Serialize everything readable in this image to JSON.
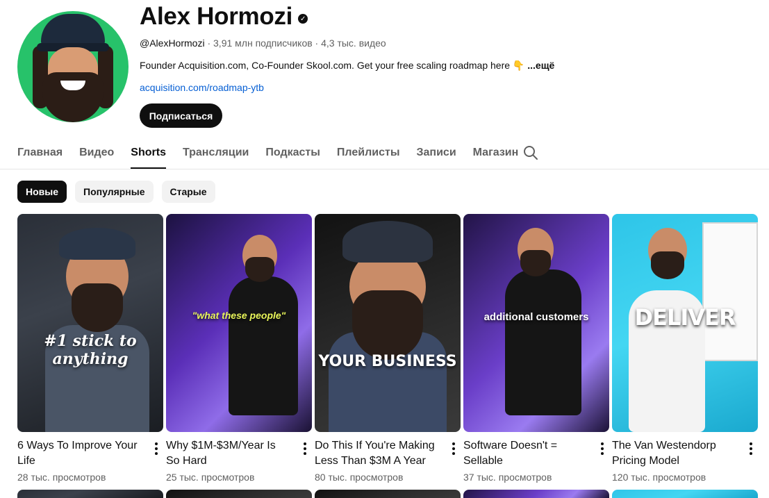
{
  "channel": {
    "name": "Alex Hormozi",
    "handle": "@AlexHormozi",
    "meta_rest": " · 3,91 млн подписчиков · 4,3 тыс. видео",
    "description": "Founder Acquisition.com, Co-Founder Skool.com. Get your free scaling roadmap here 👇 ",
    "more_label": "...ещё",
    "link": "acquisition.com/roadmap-ytb",
    "subscribe_label": "Подписаться",
    "verified_icon": "✓"
  },
  "tabs": [
    {
      "label": "Главная",
      "active": false
    },
    {
      "label": "Видео",
      "active": false
    },
    {
      "label": "Shorts",
      "active": true
    },
    {
      "label": "Трансляции",
      "active": false
    },
    {
      "label": "Подкасты",
      "active": false
    },
    {
      "label": "Плейлисты",
      "active": false
    },
    {
      "label": "Записи",
      "active": false
    },
    {
      "label": "Магазин",
      "active": false
    }
  ],
  "chips": [
    {
      "label": "Новые",
      "selected": true
    },
    {
      "label": "Популярные",
      "selected": false
    },
    {
      "label": "Старые",
      "selected": false
    }
  ],
  "shorts": [
    {
      "title": "6 Ways To Improve Your Life",
      "views": "28 тыс. просмотров",
      "caption": "#1 stick to anything"
    },
    {
      "title": "Why $1M-$3M/Year Is So Hard",
      "views": "25 тыс. просмотров",
      "caption": "\"what these people\""
    },
    {
      "title": "Do This If You're Making Less Than $3M A Year",
      "views": "80 тыс. просмотров",
      "caption": "YOUR BUSINESS"
    },
    {
      "title": "Software Doesn't = Sellable",
      "views": "37 тыс. просмотров",
      "caption": "additional customers"
    },
    {
      "title": "The Van Westendorp Pricing Model",
      "views": "120 тыс. просмотров",
      "caption": "DELIVER"
    }
  ],
  "colors": {
    "accent_link": "#065fd4",
    "active_text": "#0f0f0f",
    "muted_text": "#606060",
    "chip_bg": "#f2f2f2",
    "avatar_bg": "#27c26a"
  }
}
